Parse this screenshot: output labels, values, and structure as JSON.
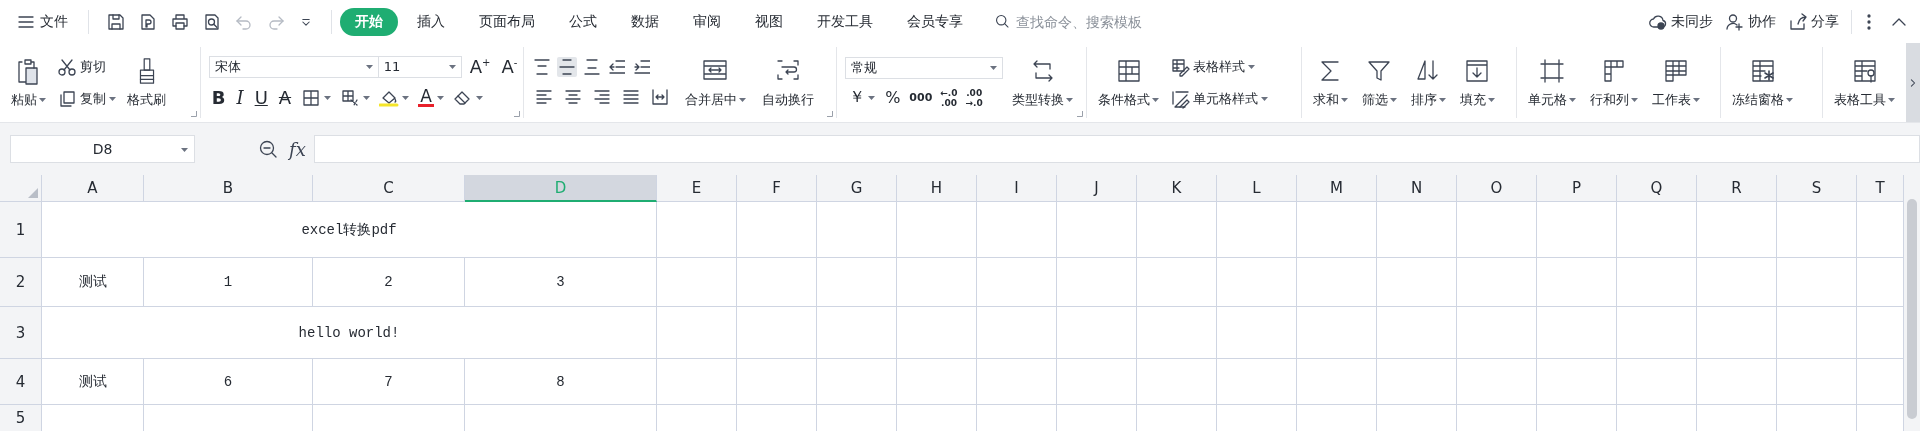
{
  "menu": {
    "label": "文件"
  },
  "quick_access": {
    "undo": {
      "disabled": true
    },
    "redo": {
      "disabled": true
    }
  },
  "tabs": [
    {
      "label": "开始",
      "selected": true
    },
    {
      "label": "插入",
      "selected": false
    },
    {
      "label": "页面布局",
      "selected": false
    },
    {
      "label": "公式",
      "selected": false
    },
    {
      "label": "数据",
      "selected": false
    },
    {
      "label": "审阅",
      "selected": false
    },
    {
      "label": "视图",
      "selected": false
    },
    {
      "label": "开发工具",
      "selected": false
    },
    {
      "label": "会员专享",
      "selected": false
    }
  ],
  "search": {
    "placeholder": "查找命令、搜索模板"
  },
  "top_actions": [
    "未同步",
    "协作",
    "分享"
  ],
  "ribbon": {
    "clipboard": {
      "paste": "粘贴",
      "cut": "剪切",
      "copy": "复制",
      "format_painter": "格式刷"
    },
    "font": {
      "name": "宋体",
      "size": "11",
      "grow": "A$^{+}$",
      "shrink": "A$^{-}$",
      "styles": [
        "B",
        "I",
        "U",
        "A"
      ],
      "font_color": "A"
    },
    "alignment": {
      "top_row": [
        {
          "selected": false
        },
        {
          "selected": true
        },
        {
          "selected": false
        },
        {
          "selected": false
        },
        {
          "selected": false
        }
      ],
      "merge": "合并居中",
      "wrap": "自动换行"
    },
    "number": {
      "format": "常规",
      "currency": "￥",
      "percent": "%",
      "thousands": "000",
      "decimals": [
        {
          "top": "←.0",
          "bottom": ".00"
        },
        {
          "top": ".00",
          "bottom": "→.0"
        }
      ],
      "convert": "类型转换"
    },
    "styles": {
      "conditional": "条件格式",
      "table_style": "表格样式",
      "cell_style": "单元格样式"
    },
    "editing": [
      "求和",
      "筛选",
      "排序",
      "填充"
    ],
    "cells": [
      "单元格",
      "行和列",
      "工作表"
    ],
    "freeze": "冻结窗格",
    "tools": "表格工具"
  },
  "formula_bar": {
    "cell_ref": "D8",
    "fx": "fx"
  },
  "sheet": {
    "columns": [
      {
        "label": "A",
        "selected": false
      },
      {
        "label": "B",
        "selected": false
      },
      {
        "label": "C",
        "selected": false
      },
      {
        "label": "D",
        "selected": true
      },
      {
        "label": "E",
        "selected": false
      },
      {
        "label": "F",
        "selected": false
      },
      {
        "label": "G",
        "selected": false
      },
      {
        "label": "H",
        "selected": false
      },
      {
        "label": "I",
        "selected": false
      },
      {
        "label": "J",
        "selected": false
      },
      {
        "label": "K",
        "selected": false
      },
      {
        "label": "L",
        "selected": false
      },
      {
        "label": "M",
        "selected": false
      },
      {
        "label": "N",
        "selected": false
      },
      {
        "label": "O",
        "selected": false
      },
      {
        "label": "P",
        "selected": false
      },
      {
        "label": "Q",
        "selected": false
      },
      {
        "label": "R",
        "selected": false
      },
      {
        "label": "S",
        "selected": false
      },
      {
        "label": "T",
        "selected": false
      }
    ],
    "rows": [
      {
        "label": "1",
        "cells": [
          {
            "text": "excel转换pdf"
          }
        ]
      },
      {
        "label": "2",
        "cells": [
          {
            "text": "测试"
          },
          {
            "text": "1"
          },
          {
            "text": "2"
          },
          {
            "text": "3"
          }
        ]
      },
      {
        "label": "3",
        "cells": [
          {
            "text": "hello world!"
          }
        ]
      },
      {
        "label": "4",
        "cells": [
          {
            "text": "测试"
          },
          {
            "text": "6"
          },
          {
            "text": "7"
          },
          {
            "text": "8"
          }
        ]
      },
      {
        "label": "5"
      }
    ]
  }
}
